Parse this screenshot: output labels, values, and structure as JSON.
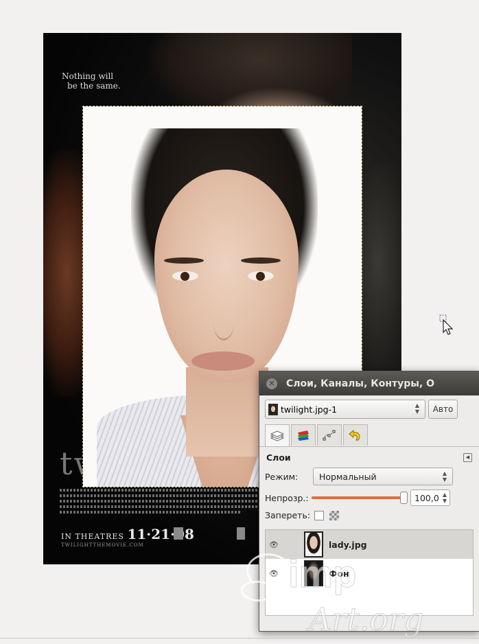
{
  "poster": {
    "tagline_line1": "Nothing will",
    "tagline_line2": "be the same.",
    "title_fragment": "tw",
    "release_prefix": "IN THEATRES",
    "release_date": "11·21·08",
    "website": "TWILIGHTTHEMOVIE.COM"
  },
  "dock": {
    "title": "Слои, Каналы, Контуры, О",
    "image_selector": "twilight.jpg-1",
    "auto_button": "Авто",
    "tabs": [
      {
        "name": "layers",
        "icon": "layers-icon"
      },
      {
        "name": "channels",
        "icon": "channels-icon"
      },
      {
        "name": "paths",
        "icon": "paths-icon"
      },
      {
        "name": "undo-history",
        "icon": "undo-icon"
      }
    ],
    "panel_title": "Слои",
    "mode_label": "Режим:",
    "mode_value": "Нормальный",
    "opacity_label": "Непрозр.:",
    "opacity_value": "100,0",
    "opacity_fraction": 1.0,
    "lock_label": "Запереть:",
    "layers": [
      {
        "name": "lady.jpg",
        "visible": true,
        "selected": true
      },
      {
        "name": "Фон",
        "visible": true,
        "selected": false
      }
    ]
  },
  "watermark": "Gimp Art.org",
  "colors": {
    "canvas_bg": "#f2f1f0",
    "titlebar": "#3d3c38",
    "slider": "#e36c3b"
  }
}
